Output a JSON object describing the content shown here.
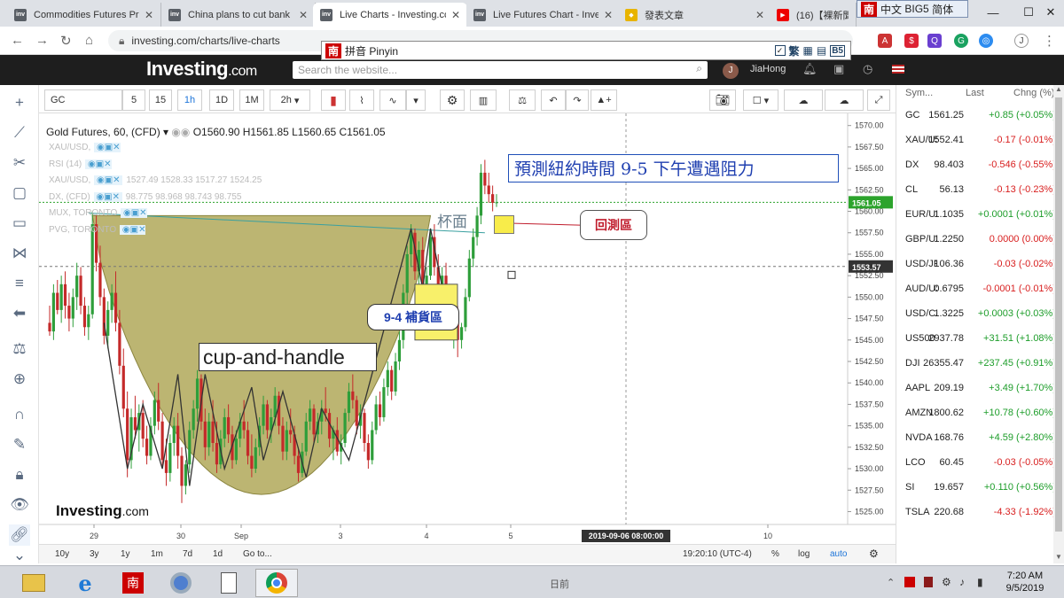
{
  "browser": {
    "tabs": [
      {
        "title": "Commodities Futures Pri",
        "icon": "investing-favicon"
      },
      {
        "title": "China plans to cut bank",
        "icon": "investing-favicon"
      },
      {
        "title": "Live Charts - Investing.cc",
        "icon": "investing-favicon",
        "active": true
      },
      {
        "title": "Live Futures Chart - Inve",
        "icon": "investing-favicon"
      },
      {
        "title": "發表文章",
        "icon": "shield-icon"
      },
      {
        "title": "(16)【裸新聞15",
        "icon": "youtube-icon"
      }
    ],
    "url": "investing.com/charts/live-charts",
    "profile_initial": "J"
  },
  "ime": {
    "top_badge": "南",
    "top_lang": "中文",
    "top_charset": "BIG5",
    "top_variant": "简体",
    "bar_badge": "南",
    "bar_label": "拼音 Pinyin",
    "bar_trad": "繁",
    "bar_b5": "B5"
  },
  "site": {
    "logo_main": "Investing",
    "logo_suffix": ".com",
    "search_placeholder": "Search the website...",
    "user_initial": "J",
    "user_name": "JiaHong"
  },
  "chart_toolbar": {
    "symbol": "GC",
    "intervals": [
      "5",
      "15",
      "1h",
      "1D",
      "1M",
      "2h"
    ],
    "active_interval": "1h"
  },
  "legend": {
    "title": "Gold Futures, 60, (CFD)",
    "ohlc": "O1560.90  H1561.85  L1560.65  C1561.05",
    "studies": [
      {
        "name": "XAU/USD,",
        "values": ""
      },
      {
        "name": "RSI (14)",
        "values": ""
      },
      {
        "name": "XAU/USD,",
        "values": "1527.49   1528.33   1517.27   1524.25"
      },
      {
        "name": "DX, (CFD)",
        "values": "98.775   98.968   98.743   98.755"
      },
      {
        "name": "MUX, TORONTO",
        "values": ""
      },
      {
        "name": "PVG, TORONTO",
        "values": ""
      }
    ]
  },
  "annotations": {
    "headline": "預測紐約時間 9-5 下午遭遇阻力",
    "cup_rim": "杯面",
    "retest_zone": "回測區",
    "replenish_zone": "9-4 補貨區",
    "pattern": "cup-and-handle",
    "watermark_main": "Investing",
    "watermark_suffix": ".com"
  },
  "chart_data": {
    "type": "candlestick",
    "title": "Gold Futures, 60, (CFD)",
    "y_ticks": [
      1570.0,
      1567.5,
      1565.0,
      1562.5,
      1560.0,
      1557.5,
      1555.0,
      1552.5,
      1550.0,
      1547.5,
      1545.0,
      1542.5,
      1540.0,
      1537.5,
      1535.0,
      1532.5,
      1530.0,
      1527.5,
      1525.0
    ],
    "ylim": [
      1523.5,
      1571.0
    ],
    "x_ticks": [
      "29",
      "30",
      "Sep",
      "3",
      "4",
      "5",
      "10"
    ],
    "current_price": "1561.05",
    "crosshair_price": "1553.57",
    "crosshair_time": "2019-09-06 08:00:00",
    "candles": [
      {
        "o": 1547.0,
        "h": 1549.0,
        "l": 1545.5,
        "c": 1546.0
      },
      {
        "o": 1546.0,
        "h": 1551.5,
        "l": 1545.0,
        "c": 1550.5
      },
      {
        "o": 1550.5,
        "h": 1552.0,
        "l": 1548.0,
        "c": 1548.5
      },
      {
        "o": 1548.5,
        "h": 1552.5,
        "l": 1547.0,
        "c": 1551.5
      },
      {
        "o": 1551.5,
        "h": 1553.0,
        "l": 1547.5,
        "c": 1549.0
      },
      {
        "o": 1549.0,
        "h": 1550.5,
        "l": 1546.0,
        "c": 1547.5
      },
      {
        "o": 1547.5,
        "h": 1551.0,
        "l": 1546.5,
        "c": 1550.0
      },
      {
        "o": 1550.0,
        "h": 1554.0,
        "l": 1548.5,
        "c": 1552.5
      },
      {
        "o": 1552.5,
        "h": 1553.5,
        "l": 1548.0,
        "c": 1549.0
      },
      {
        "o": 1549.0,
        "h": 1550.0,
        "l": 1545.5,
        "c": 1546.5
      },
      {
        "o": 1546.5,
        "h": 1549.0,
        "l": 1545.0,
        "c": 1548.0
      },
      {
        "o": 1548.0,
        "h": 1560.0,
        "l": 1547.5,
        "c": 1558.5
      },
      {
        "o": 1558.5,
        "h": 1559.5,
        "l": 1553.0,
        "c": 1554.0
      },
      {
        "o": 1554.0,
        "h": 1556.0,
        "l": 1549.0,
        "c": 1550.0
      },
      {
        "o": 1550.0,
        "h": 1551.0,
        "l": 1544.5,
        "c": 1545.5
      },
      {
        "o": 1545.5,
        "h": 1549.5,
        "l": 1544.0,
        "c": 1548.5
      },
      {
        "o": 1548.5,
        "h": 1551.5,
        "l": 1547.0,
        "c": 1550.5
      },
      {
        "o": 1550.5,
        "h": 1553.0,
        "l": 1546.0,
        "c": 1547.0
      },
      {
        "o": 1547.0,
        "h": 1548.5,
        "l": 1541.0,
        "c": 1542.0
      },
      {
        "o": 1542.0,
        "h": 1544.0,
        "l": 1536.0,
        "c": 1537.0
      },
      {
        "o": 1537.0,
        "h": 1539.0,
        "l": 1529.0,
        "c": 1531.0
      },
      {
        "o": 1531.0,
        "h": 1537.0,
        "l": 1530.0,
        "c": 1536.0
      },
      {
        "o": 1536.0,
        "h": 1538.5,
        "l": 1533.5,
        "c": 1534.5
      },
      {
        "o": 1534.5,
        "h": 1537.5,
        "l": 1532.0,
        "c": 1536.5
      },
      {
        "o": 1536.5,
        "h": 1538.0,
        "l": 1532.5,
        "c": 1533.5
      },
      {
        "o": 1533.5,
        "h": 1535.0,
        "l": 1530.5,
        "c": 1531.5
      },
      {
        "o": 1531.5,
        "h": 1536.0,
        "l": 1531.0,
        "c": 1535.0
      },
      {
        "o": 1535.0,
        "h": 1539.0,
        "l": 1534.0,
        "c": 1538.0
      },
      {
        "o": 1538.0,
        "h": 1540.0,
        "l": 1534.5,
        "c": 1535.5
      },
      {
        "o": 1535.5,
        "h": 1536.5,
        "l": 1530.0,
        "c": 1531.0
      },
      {
        "o": 1531.0,
        "h": 1533.5,
        "l": 1528.0,
        "c": 1529.5
      },
      {
        "o": 1529.5,
        "h": 1534.0,
        "l": 1528.5,
        "c": 1533.0
      },
      {
        "o": 1533.0,
        "h": 1536.0,
        "l": 1531.5,
        "c": 1535.0
      },
      {
        "o": 1535.0,
        "h": 1536.5,
        "l": 1530.0,
        "c": 1531.5
      },
      {
        "o": 1531.5,
        "h": 1532.5,
        "l": 1526.0,
        "c": 1528.0
      },
      {
        "o": 1528.0,
        "h": 1531.0,
        "l": 1527.0,
        "c": 1530.5
      },
      {
        "o": 1530.5,
        "h": 1535.5,
        "l": 1529.5,
        "c": 1534.5
      },
      {
        "o": 1534.5,
        "h": 1538.0,
        "l": 1533.5,
        "c": 1537.0
      },
      {
        "o": 1537.0,
        "h": 1541.5,
        "l": 1535.5,
        "c": 1540.5
      },
      {
        "o": 1540.5,
        "h": 1541.0,
        "l": 1534.5,
        "c": 1535.5
      },
      {
        "o": 1535.5,
        "h": 1537.0,
        "l": 1531.0,
        "c": 1532.5
      },
      {
        "o": 1532.5,
        "h": 1536.5,
        "l": 1531.5,
        "c": 1535.5
      },
      {
        "o": 1535.5,
        "h": 1538.0,
        "l": 1532.0,
        "c": 1533.0
      },
      {
        "o": 1533.0,
        "h": 1535.5,
        "l": 1529.5,
        "c": 1530.5
      },
      {
        "o": 1530.5,
        "h": 1534.5,
        "l": 1530.0,
        "c": 1533.5
      },
      {
        "o": 1533.5,
        "h": 1537.0,
        "l": 1532.5,
        "c": 1536.0
      },
      {
        "o": 1536.0,
        "h": 1537.5,
        "l": 1533.0,
        "c": 1534.0
      },
      {
        "o": 1534.0,
        "h": 1535.0,
        "l": 1530.0,
        "c": 1531.0
      },
      {
        "o": 1531.0,
        "h": 1534.5,
        "l": 1530.5,
        "c": 1533.5
      },
      {
        "o": 1533.5,
        "h": 1536.5,
        "l": 1532.5,
        "c": 1535.5
      },
      {
        "o": 1535.5,
        "h": 1538.0,
        "l": 1533.5,
        "c": 1534.5
      },
      {
        "o": 1534.5,
        "h": 1535.5,
        "l": 1530.5,
        "c": 1531.5
      },
      {
        "o": 1531.5,
        "h": 1534.0,
        "l": 1529.0,
        "c": 1530.0
      },
      {
        "o": 1530.0,
        "h": 1533.5,
        "l": 1529.5,
        "c": 1532.5
      },
      {
        "o": 1532.5,
        "h": 1536.0,
        "l": 1531.5,
        "c": 1535.0
      },
      {
        "o": 1535.0,
        "h": 1538.5,
        "l": 1534.0,
        "c": 1537.5
      },
      {
        "o": 1537.5,
        "h": 1538.0,
        "l": 1533.5,
        "c": 1534.5
      },
      {
        "o": 1534.5,
        "h": 1537.0,
        "l": 1533.0,
        "c": 1536.0
      },
      {
        "o": 1536.0,
        "h": 1539.5,
        "l": 1535.0,
        "c": 1538.5
      },
      {
        "o": 1538.5,
        "h": 1539.0,
        "l": 1534.0,
        "c": 1535.0
      },
      {
        "o": 1535.0,
        "h": 1536.0,
        "l": 1531.0,
        "c": 1532.0
      },
      {
        "o": 1532.0,
        "h": 1535.5,
        "l": 1531.0,
        "c": 1534.5
      },
      {
        "o": 1534.5,
        "h": 1537.0,
        "l": 1533.0,
        "c": 1534.0
      },
      {
        "o": 1534.0,
        "h": 1535.0,
        "l": 1530.5,
        "c": 1531.5
      },
      {
        "o": 1531.5,
        "h": 1532.5,
        "l": 1528.5,
        "c": 1529.5
      },
      {
        "o": 1529.5,
        "h": 1533.0,
        "l": 1529.0,
        "c": 1532.0
      },
      {
        "o": 1532.0,
        "h": 1536.5,
        "l": 1531.5,
        "c": 1535.5
      },
      {
        "o": 1535.5,
        "h": 1538.0,
        "l": 1534.5,
        "c": 1537.0
      },
      {
        "o": 1537.0,
        "h": 1537.5,
        "l": 1533.0,
        "c": 1534.0
      },
      {
        "o": 1534.0,
        "h": 1536.5,
        "l": 1533.0,
        "c": 1535.5
      },
      {
        "o": 1535.5,
        "h": 1538.0,
        "l": 1534.0,
        "c": 1537.0
      },
      {
        "o": 1537.0,
        "h": 1539.5,
        "l": 1535.5,
        "c": 1536.5
      },
      {
        "o": 1536.5,
        "h": 1537.0,
        "l": 1532.5,
        "c": 1533.5
      },
      {
        "o": 1533.5,
        "h": 1535.0,
        "l": 1531.0,
        "c": 1534.5
      },
      {
        "o": 1534.5,
        "h": 1536.0,
        "l": 1531.5,
        "c": 1532.0
      },
      {
        "o": 1532.0,
        "h": 1534.0,
        "l": 1530.5,
        "c": 1533.0
      },
      {
        "o": 1533.0,
        "h": 1537.0,
        "l": 1532.5,
        "c": 1536.5
      },
      {
        "o": 1536.5,
        "h": 1540.0,
        "l": 1535.5,
        "c": 1539.0
      },
      {
        "o": 1539.0,
        "h": 1541.0,
        "l": 1537.0,
        "c": 1538.0
      },
      {
        "o": 1538.0,
        "h": 1538.5,
        "l": 1534.0,
        "c": 1535.0
      },
      {
        "o": 1535.0,
        "h": 1537.5,
        "l": 1533.5,
        "c": 1536.5
      },
      {
        "o": 1536.5,
        "h": 1537.0,
        "l": 1532.0,
        "c": 1533.0
      },
      {
        "o": 1533.0,
        "h": 1534.0,
        "l": 1530.0,
        "c": 1531.0
      },
      {
        "o": 1531.0,
        "h": 1535.5,
        "l": 1530.5,
        "c": 1534.5
      },
      {
        "o": 1534.5,
        "h": 1538.5,
        "l": 1534.0,
        "c": 1537.5
      },
      {
        "o": 1537.5,
        "h": 1539.0,
        "l": 1535.0,
        "c": 1536.0
      },
      {
        "o": 1536.0,
        "h": 1540.5,
        "l": 1535.5,
        "c": 1539.5
      },
      {
        "o": 1539.5,
        "h": 1542.5,
        "l": 1538.5,
        "c": 1541.5
      },
      {
        "o": 1541.5,
        "h": 1542.0,
        "l": 1538.0,
        "c": 1539.0
      },
      {
        "o": 1539.0,
        "h": 1543.5,
        "l": 1538.5,
        "c": 1542.5
      },
      {
        "o": 1542.5,
        "h": 1546.0,
        "l": 1541.5,
        "c": 1545.0
      },
      {
        "o": 1545.0,
        "h": 1551.5,
        "l": 1544.0,
        "c": 1550.5
      },
      {
        "o": 1550.5,
        "h": 1556.0,
        "l": 1549.0,
        "c": 1555.0
      },
      {
        "o": 1555.0,
        "h": 1558.5,
        "l": 1553.5,
        "c": 1557.5
      },
      {
        "o": 1557.5,
        "h": 1558.0,
        "l": 1552.0,
        "c": 1553.0
      },
      {
        "o": 1553.0,
        "h": 1556.5,
        "l": 1551.5,
        "c": 1555.5
      },
      {
        "o": 1555.5,
        "h": 1557.0,
        "l": 1550.0,
        "c": 1551.5
      },
      {
        "o": 1551.5,
        "h": 1553.5,
        "l": 1549.0,
        "c": 1552.5
      },
      {
        "o": 1552.5,
        "h": 1558.0,
        "l": 1552.0,
        "c": 1557.0
      },
      {
        "o": 1557.0,
        "h": 1558.5,
        "l": 1552.5,
        "c": 1553.5
      },
      {
        "o": 1553.5,
        "h": 1555.0,
        "l": 1548.5,
        "c": 1549.5
      },
      {
        "o": 1549.5,
        "h": 1553.5,
        "l": 1548.5,
        "c": 1552.5
      },
      {
        "o": 1552.5,
        "h": 1554.0,
        "l": 1549.0,
        "c": 1550.0
      },
      {
        "o": 1550.0,
        "h": 1551.0,
        "l": 1545.0,
        "c": 1546.0
      },
      {
        "o": 1546.0,
        "h": 1548.5,
        "l": 1544.0,
        "c": 1547.5
      },
      {
        "o": 1547.5,
        "h": 1549.0,
        "l": 1543.0,
        "c": 1545.0
      },
      {
        "o": 1545.0,
        "h": 1547.0,
        "l": 1544.0,
        "c": 1546.5
      },
      {
        "o": 1546.5,
        "h": 1551.0,
        "l": 1546.0,
        "c": 1550.0
      },
      {
        "o": 1550.0,
        "h": 1555.5,
        "l": 1549.5,
        "c": 1554.5
      },
      {
        "o": 1554.5,
        "h": 1558.0,
        "l": 1553.5,
        "c": 1557.0
      },
      {
        "o": 1557.0,
        "h": 1560.5,
        "l": 1556.0,
        "c": 1559.5
      },
      {
        "o": 1559.5,
        "h": 1565.5,
        "l": 1558.5,
        "c": 1564.5
      },
      {
        "o": 1564.5,
        "h": 1566.0,
        "l": 1562.0,
        "c": 1563.0
      },
      {
        "o": 1563.0,
        "h": 1564.5,
        "l": 1561.0,
        "c": 1562.0
      },
      {
        "o": 1562.0,
        "h": 1563.0,
        "l": 1560.0,
        "c": 1561.0
      },
      {
        "o": 1561.0,
        "h": 1562.0,
        "l": 1560.5,
        "c": 1561.05
      }
    ]
  },
  "bottom": {
    "ranges": [
      "10y",
      "3y",
      "1y",
      "1m",
      "7d",
      "1d",
      "Go to..."
    ],
    "time": "19:20:10 (UTC-4)",
    "pct": "%",
    "log": "log",
    "auto": "auto"
  },
  "watchlist": {
    "headers": [
      "Sym...",
      "Last",
      "Chng (%)"
    ],
    "rows": [
      {
        "sym": "GC",
        "last": "1561.25",
        "chg": "+0.85 (+0.05%)",
        "dir": "pos"
      },
      {
        "sym": "XAU/USD",
        "last": "1552.41",
        "chg": "-0.17 (-0.01%)",
        "dir": "neg"
      },
      {
        "sym": "DX",
        "last": "98.403",
        "chg": "-0.546 (-0.55%)",
        "dir": "neg"
      },
      {
        "sym": "CL",
        "last": "56.13",
        "chg": "-0.13 (-0.23%)",
        "dir": "neg"
      },
      {
        "sym": "EUR/USD",
        "last": "1.1035",
        "chg": "+0.0001 (+0.01%)",
        "dir": "pos"
      },
      {
        "sym": "GBP/USD",
        "last": "1.2250",
        "chg": "0.0000 (0.00%)",
        "dir": "zero"
      },
      {
        "sym": "USD/JPY",
        "last": "106.36",
        "chg": "-0.03 (-0.02%)",
        "dir": "neg"
      },
      {
        "sym": "AUD/USD",
        "last": "0.6795",
        "chg": "-0.0001 (-0.01%)",
        "dir": "neg"
      },
      {
        "sym": "USD/CAD",
        "last": "1.3225",
        "chg": "+0.0003 (+0.03%)",
        "dir": "pos"
      },
      {
        "sym": "US500",
        "last": "2937.78",
        "chg": "+31.51 (+1.08%)",
        "dir": "pos"
      },
      {
        "sym": "DJI",
        "last": "26355.47",
        "chg": "+237.45 (+0.91%)",
        "dir": "pos"
      },
      {
        "sym": "AAPL",
        "last": "209.19",
        "chg": "+3.49 (+1.70%)",
        "dir": "pos"
      },
      {
        "sym": "AMZN",
        "last": "1800.62",
        "chg": "+10.78 (+0.60%)",
        "dir": "pos"
      },
      {
        "sym": "NVDA",
        "last": "168.76",
        "chg": "+4.59 (+2.80%)",
        "dir": "pos"
      },
      {
        "sym": "LCO",
        "last": "60.45",
        "chg": "-0.03 (-0.05%)",
        "dir": "neg"
      },
      {
        "sym": "SI",
        "last": "19.657",
        "chg": "+0.110 (+0.56%)",
        "dir": "pos"
      },
      {
        "sym": "TSLA",
        "last": "220.68",
        "chg": "-4.33 (-1.92%)",
        "dir": "neg"
      }
    ]
  },
  "taskbar": {
    "center": "日前",
    "time": "7:20 AM",
    "date": "9/5/2019"
  },
  "colors": {
    "bull": "#2e9e3a",
    "bear": "#c42a2a",
    "cup_fill": "#a9a04a",
    "accent": "#1c74d9",
    "retest_box": "#f8f04a",
    "price_label": "#2ca32c"
  }
}
